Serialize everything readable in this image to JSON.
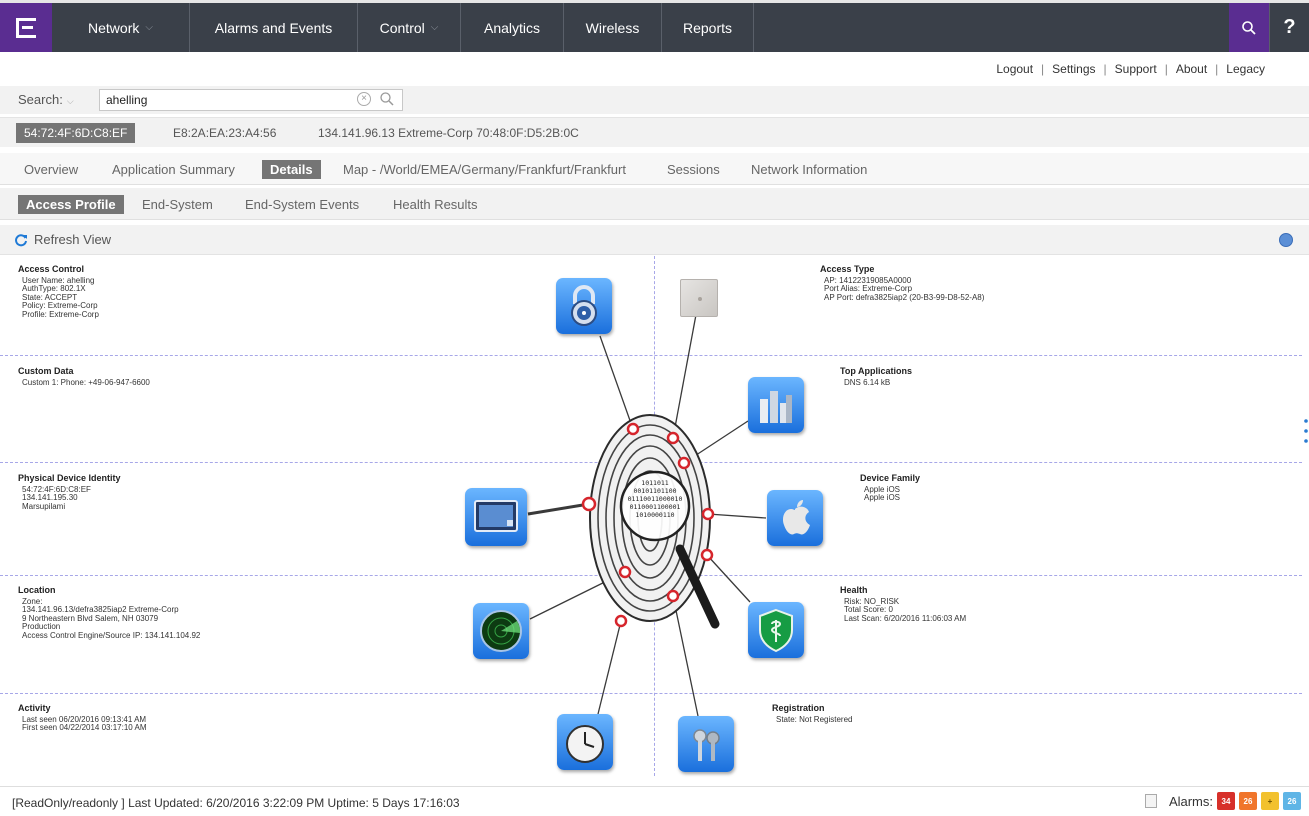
{
  "nav": {
    "tabs": [
      {
        "label": "Network",
        "has_caret": true
      },
      {
        "label": "Alarms and Events",
        "has_caret": false
      },
      {
        "label": "Control",
        "has_caret": true
      },
      {
        "label": "Analytics",
        "has_caret": false
      },
      {
        "label": "Wireless",
        "has_caret": false
      },
      {
        "label": "Reports",
        "has_caret": false
      }
    ],
    "help": "?",
    "brand_color": "#5a2d91"
  },
  "util_links": [
    "Logout",
    "Settings",
    "Support",
    "About",
    "Legacy"
  ],
  "search": {
    "label": "Search:",
    "value": "ahelling"
  },
  "identifiers": {
    "selected": "54:72:4F:6D:C8:EF",
    "other1": "E8:2A:EA:23:A4:56",
    "other2": "134.141.96.13 Extreme-Corp 70:48:0F:D5:2B:0C"
  },
  "detail_tabs": [
    "Overview",
    "Application Summary",
    "Details",
    "Map - /World/EMEA/Germany/Frankfurt/Frankfurt",
    "Sessions",
    "Network Information"
  ],
  "sub_tabs": [
    "Access Profile",
    "End-System",
    "End-System Events",
    "Health Results"
  ],
  "toolbar": {
    "refresh": "Refresh View"
  },
  "sections": {
    "access_control": {
      "title": "Access Control",
      "lines": [
        "User Name: ahelling",
        "AuthType: 802.1X",
        "State: ACCEPT",
        "Policy: Extreme-Corp",
        "Profile: Extreme-Corp"
      ]
    },
    "custom_data": {
      "title": "Custom Data",
      "lines": [
        "Custom 1: Phone: +49-06-947-6600"
      ]
    },
    "physical": {
      "title": "Physical Device Identity",
      "lines": [
        "54:72:4F:6D:C8:EF",
        "134.141.195.30",
        "Marsupilami"
      ]
    },
    "location": {
      "title": "Location",
      "lines": [
        "Zone:",
        "134.141.96.13/defra3825iap2 Extreme-Corp",
        "9 Northeastern Blvd Salem, NH 03079",
        "Production",
        "Access Control Engine/Source IP: 134.141.104.92"
      ]
    },
    "activity": {
      "title": "Activity",
      "lines": [
        "Last seen 06/20/2016 09:13:41 AM",
        "First seen 04/22/2014 03:17:10 AM"
      ]
    },
    "access_type": {
      "title": "Access Type",
      "lines": [
        "AP: 14122319085A0000",
        "Port Alias: Extreme-Corp",
        "AP Port: defra3825iap2 (20-B3-99-D8-52-A8)"
      ]
    },
    "top_apps": {
      "title": "Top Applications",
      "lines": [
        "DNS 6.14 kB"
      ]
    },
    "device_family": {
      "title": "Device Family",
      "lines": [
        "Apple iOS",
        "Apple iOS"
      ]
    },
    "health": {
      "title": "Health",
      "lines": [
        "Risk: NO_RISK",
        "Total Score: 0",
        "Last Scan: 6/20/2016 11:06:03 AM"
      ]
    },
    "registration": {
      "title": "Registration",
      "lines": [
        "State: Not Registered"
      ]
    }
  },
  "fingerprint_binary": [
    "1011011",
    "00101101100",
    "01110011000010",
    "0110001100001",
    "1010000110"
  ],
  "status": {
    "text": "[ReadOnly/readonly ]  Last Updated: 6/20/2016 3:22:09 PM  Uptime: 5 Days 17:16:03",
    "alarms_label": "Alarms:",
    "badges": [
      {
        "count": "34",
        "color": "#d7302a"
      },
      {
        "count": "26",
        "color": "#f0752b"
      },
      {
        "count": "+",
        "color": "#f2c12e"
      },
      {
        "count": "26",
        "color": "#5fb5e6"
      }
    ]
  }
}
